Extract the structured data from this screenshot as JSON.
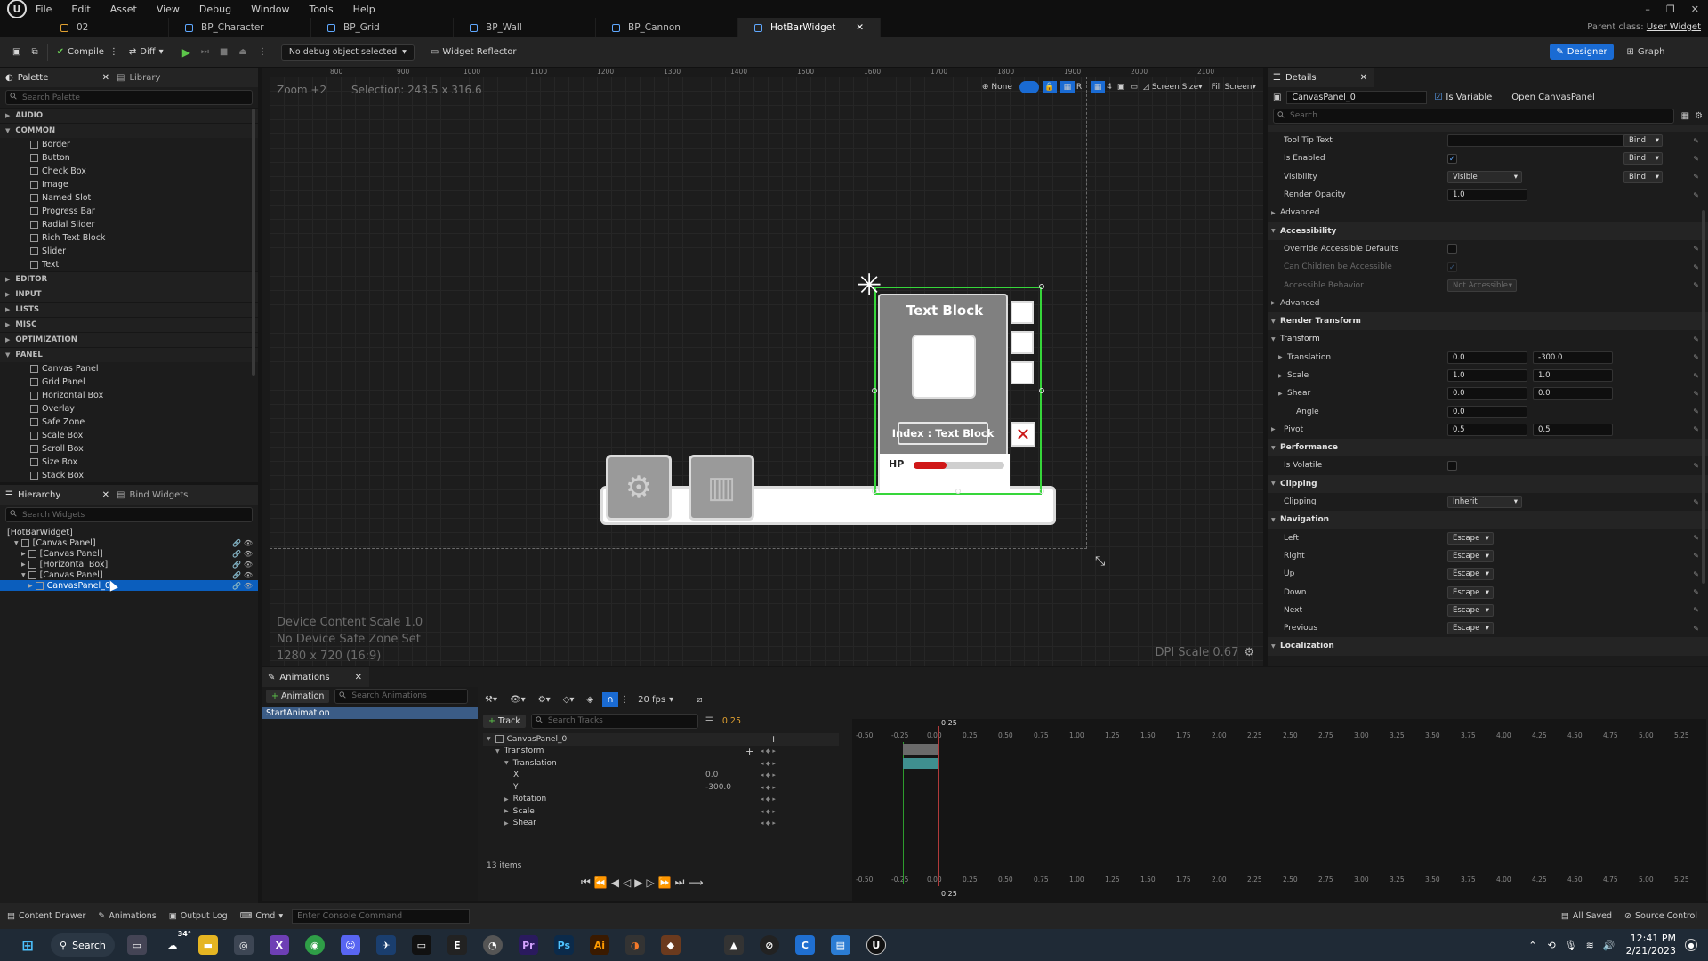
{
  "menu": [
    "File",
    "Edit",
    "Asset",
    "View",
    "Debug",
    "Window",
    "Tools",
    "Help"
  ],
  "tabs": [
    {
      "label": "02",
      "active": false
    },
    {
      "label": "BP_Character",
      "active": false
    },
    {
      "label": "BP_Grid",
      "active": false
    },
    {
      "label": "BP_Wall",
      "active": false
    },
    {
      "label": "BP_Cannon",
      "active": false
    },
    {
      "label": "HotBarWidget",
      "active": true
    }
  ],
  "parent_class_label": "Parent class:",
  "parent_class_value": "User Widget",
  "toolbar": {
    "compile": "Compile",
    "diff": "Diff",
    "debug_select": "No debug object selected",
    "widget_reflector": "Widget Reflector",
    "designer": "Designer",
    "graph": "Graph"
  },
  "palette": {
    "title": "Palette",
    "library": "Library",
    "search_placeholder": "Search Palette",
    "categories": [
      {
        "name": "AUDIO",
        "open": false,
        "items": []
      },
      {
        "name": "COMMON",
        "open": true,
        "items": [
          "Border",
          "Button",
          "Check Box",
          "Image",
          "Named Slot",
          "Progress Bar",
          "Radial Slider",
          "Rich Text Block",
          "Slider",
          "Text"
        ]
      },
      {
        "name": "EDITOR",
        "open": false,
        "items": []
      },
      {
        "name": "INPUT",
        "open": false,
        "items": []
      },
      {
        "name": "LISTS",
        "open": false,
        "items": []
      },
      {
        "name": "MISC",
        "open": false,
        "items": []
      },
      {
        "name": "OPTIMIZATION",
        "open": false,
        "items": []
      },
      {
        "name": "PANEL",
        "open": true,
        "items": [
          "Canvas Panel",
          "Grid Panel",
          "Horizontal Box",
          "Overlay",
          "Safe Zone",
          "Scale Box",
          "Scroll Box",
          "Size Box",
          "Stack Box"
        ]
      }
    ]
  },
  "hierarchy": {
    "title": "Hierarchy",
    "bind_widgets": "Bind Widgets",
    "search_placeholder": "Search Widgets",
    "rows": [
      {
        "label": "[HotBarWidget]",
        "indent": 0,
        "selected": false
      },
      {
        "label": "[Canvas Panel]",
        "indent": 1,
        "selected": false
      },
      {
        "label": "[Canvas Panel]",
        "indent": 2,
        "selected": false
      },
      {
        "label": "[Horizontal Box]",
        "indent": 2,
        "selected": false
      },
      {
        "label": "[Canvas Panel]",
        "indent": 2,
        "selected": false
      },
      {
        "label": "CanvasPanel_0",
        "indent": 3,
        "selected": true
      }
    ]
  },
  "viewport": {
    "zoom": "Zoom +2",
    "selection": "Selection: 243.5 x 316.6",
    "none": "None",
    "r": "R",
    "grid_snap": "4",
    "screen_size": "Screen Size",
    "fill_screen": "Fill Screen",
    "device_scale": "Device Content Scale 1.0",
    "safe_zone": "No Device Safe Zone Set",
    "resolution": "1280 x 720 (16:9)",
    "dpi_scale": "DPI Scale 0.67",
    "ruler_labels": [
      "800",
      "900",
      "1000",
      "1100",
      "1200",
      "1300",
      "1400",
      "1500",
      "1600",
      "1700",
      "1800",
      "1900",
      "2000",
      "2100"
    ],
    "widget": {
      "title_text": "Text Block",
      "index_text": "Index : Text Block",
      "hp_label": "HP",
      "hp_percent": 0.36
    }
  },
  "details": {
    "title": "Details",
    "name": "CanvasPanel_0",
    "is_variable": "Is Variable",
    "open_panel": "Open CanvasPanel",
    "search_placeholder": "Search",
    "rows": [
      {
        "label": "Tool Tip Text",
        "type": "text",
        "value": "",
        "bind": "Bind"
      },
      {
        "label": "Is Enabled",
        "type": "check",
        "checked": true,
        "bind": "Bind"
      },
      {
        "label": "Visibility",
        "type": "dropdown",
        "value": "Visible",
        "bind": "Bind"
      },
      {
        "label": "Render Opacity",
        "type": "text",
        "value": "1.0"
      },
      {
        "label": "Advanced",
        "type": "collapsed"
      },
      {
        "label": "Accessibility",
        "type": "section"
      },
      {
        "label": "Override Accessible Defaults",
        "type": "check",
        "checked": false
      },
      {
        "label": "Can Children be Accessible",
        "type": "check",
        "checked": true,
        "dim": true
      },
      {
        "label": "Accessible Behavior",
        "type": "dropdown",
        "value": "Not Accessible",
        "dim": true
      },
      {
        "label": "Advanced",
        "type": "collapsed"
      },
      {
        "label": "Render Transform",
        "type": "section"
      },
      {
        "label": "Transform",
        "type": "subsection"
      },
      {
        "label": "Translation",
        "type": "pair",
        "a": "0.0",
        "b": "-300.0",
        "child": true
      },
      {
        "label": "Scale",
        "type": "pair",
        "a": "1.0",
        "b": "1.0",
        "child": true
      },
      {
        "label": "Shear",
        "type": "pair",
        "a": "0.0",
        "b": "0.0",
        "child": true
      },
      {
        "label": "Angle",
        "type": "text",
        "value": "0.0",
        "child": true
      },
      {
        "label": "Pivot",
        "type": "pair",
        "a": "0.5",
        "b": "0.5"
      },
      {
        "label": "Performance",
        "type": "section"
      },
      {
        "label": "Is Volatile",
        "type": "check",
        "checked": false
      },
      {
        "label": "Clipping",
        "type": "section"
      },
      {
        "label": "Clipping",
        "type": "dropdown",
        "value": "Inherit"
      },
      {
        "label": "Navigation",
        "type": "section"
      },
      {
        "label": "Left",
        "type": "dropdown",
        "value": "Escape"
      },
      {
        "label": "Right",
        "type": "dropdown",
        "value": "Escape"
      },
      {
        "label": "Up",
        "type": "dropdown",
        "value": "Escape"
      },
      {
        "label": "Down",
        "type": "dropdown",
        "value": "Escape"
      },
      {
        "label": "Next",
        "type": "dropdown",
        "value": "Escape"
      },
      {
        "label": "Previous",
        "type": "dropdown",
        "value": "Escape"
      },
      {
        "label": "Localization",
        "type": "section"
      }
    ]
  },
  "animations": {
    "title": "Animations",
    "add_button": "Animation",
    "search_placeholder": "Search Animations",
    "list": [
      "StartAnimation"
    ],
    "track_button": "Track",
    "track_search": "Search Tracks",
    "fps": "20 fps",
    "current_time": "0.25",
    "tracks": [
      {
        "label": "CanvasPanel_0",
        "indent": 0
      },
      {
        "label": "Transform",
        "indent": 1
      },
      {
        "label": "Translation",
        "indent": 2
      },
      {
        "label": "X",
        "indent": 3,
        "value": "0.0"
      },
      {
        "label": "Y",
        "indent": 3,
        "value": "-300.0"
      },
      {
        "label": "Rotation",
        "indent": 2
      },
      {
        "label": "Scale",
        "indent": 2
      },
      {
        "label": "Shear",
        "indent": 2
      }
    ],
    "items_count": "13 items",
    "timeline_labels": [
      "-0.50",
      "-0.25",
      "0.00",
      "0.25",
      "0.50",
      "0.75",
      "1.00",
      "1.25",
      "1.50",
      "1.75",
      "2.00",
      "2.25",
      "2.50",
      "2.75",
      "3.00",
      "3.25",
      "3.50",
      "3.75",
      "4.00",
      "4.25",
      "4.50",
      "4.75",
      "5.00",
      "5.25"
    ]
  },
  "statusbar": {
    "content_drawer": "Content Drawer",
    "animations": "Animations",
    "output_log": "Output Log",
    "cmd": "Cmd",
    "console_placeholder": "Enter Console Command",
    "all_saved": "All Saved",
    "source_control": "Source Control"
  },
  "taskbar": {
    "search": "Search",
    "weather": "34°",
    "time": "12:41 PM",
    "date": "2/21/2023"
  }
}
